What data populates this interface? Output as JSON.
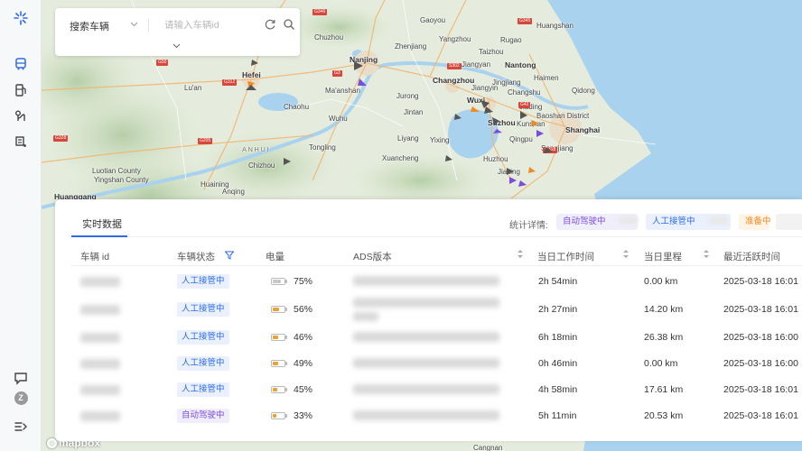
{
  "search": {
    "select_label": "搜索车辆",
    "input_placeholder": "请输入车辆id"
  },
  "map": {
    "attribution": "mapbox",
    "cities": [
      {
        "name": "Chuzhou"
      },
      {
        "name": "Hefei",
        "big": true
      },
      {
        "name": "Lu'an"
      },
      {
        "name": "Chaohu"
      },
      {
        "name": "Ma'anshan"
      },
      {
        "name": "Nanjing",
        "big": true
      },
      {
        "name": "Zhenjiang"
      },
      {
        "name": "Yangzhou"
      },
      {
        "name": "Taizhou"
      },
      {
        "name": "Nantong",
        "big": true
      },
      {
        "name": "Changzhou",
        "big": true
      },
      {
        "name": "Wuxi",
        "big": true
      },
      {
        "name": "Suzhou",
        "big": true
      },
      {
        "name": "Shanghai",
        "big": true
      },
      {
        "name": "Wuhu"
      },
      {
        "name": "Tongling"
      },
      {
        "name": "Chizhou"
      },
      {
        "name": "Xuancheng"
      },
      {
        "name": "Huzhou"
      },
      {
        "name": "Jiaxing"
      },
      {
        "name": "Anqing"
      },
      {
        "name": "Huangshan"
      },
      {
        "name": "Qidong"
      },
      {
        "name": "Luotian County"
      },
      {
        "name": "Yingshan County"
      },
      {
        "name": "Huanggang",
        "big": true
      },
      {
        "name": "Cangnan"
      },
      {
        "name": "Gaoyou"
      },
      {
        "name": "Jiangyin"
      },
      {
        "name": "Changshu"
      },
      {
        "name": "Baoshan District"
      },
      {
        "name": "Jiading"
      },
      {
        "name": "Qingpu"
      },
      {
        "name": "Songjiang"
      },
      {
        "name": "Kunshan"
      },
      {
        "name": "Haimen"
      },
      {
        "name": "Rugao"
      },
      {
        "name": "Jingjiang"
      },
      {
        "name": "Jurong"
      },
      {
        "name": "Liyang"
      },
      {
        "name": "Yixing"
      },
      {
        "name": "Jintan"
      },
      {
        "name": "Huaining"
      },
      {
        "name": "Jiangyan"
      }
    ],
    "region_label": "ANHUI",
    "road_shields": [
      "G50",
      "G3",
      "G312",
      "G42",
      "G205",
      "G328",
      "G318",
      "G346",
      "G345",
      "S302"
    ]
  },
  "panel": {
    "tab_label": "实时数据",
    "stats_label": "统计详情:",
    "stats": {
      "auto": "自动驾驶中",
      "manual": "人工接管中",
      "ready": "准备中"
    },
    "columns": {
      "vehicle_id": "车辆 id",
      "status": "车辆状态",
      "battery": "电量",
      "ads": "ADS版本",
      "work_time": "当日工作时间",
      "mileage": "当日里程",
      "last_active": "最近活跃时间"
    },
    "rows": [
      {
        "status": "人工接管中",
        "status_type": "manual",
        "battery": "75%",
        "battery_level": 0.75,
        "battery_color": "#c8c8c8",
        "work_time": "2h 54min",
        "mileage": "0.00 km",
        "last_active": "2025-03-18 16:01"
      },
      {
        "status": "人工接管中",
        "status_type": "manual",
        "battery": "56%",
        "battery_level": 0.56,
        "battery_color": "#f0a030",
        "work_time": "2h 27min",
        "mileage": "14.20 km",
        "last_active": "2025-03-18 16:01"
      },
      {
        "status": "人工接管中",
        "status_type": "manual",
        "battery": "46%",
        "battery_level": 0.46,
        "battery_color": "#f0a030",
        "work_time": "6h 18min",
        "mileage": "26.38 km",
        "last_active": "2025-03-18 16:00"
      },
      {
        "status": "人工接管中",
        "status_type": "manual",
        "battery": "49%",
        "battery_level": 0.49,
        "battery_color": "#f0a030",
        "work_time": "0h 46min",
        "mileage": "0.00 km",
        "last_active": "2025-03-18 16:00"
      },
      {
        "status": "人工接管中",
        "status_type": "manual",
        "battery": "45%",
        "battery_level": 0.45,
        "battery_color": "#f0a030",
        "work_time": "4h 58min",
        "mileage": "17.61 km",
        "last_active": "2025-03-18 16:01"
      },
      {
        "status": "自动驾驶中",
        "status_type": "auto",
        "battery": "33%",
        "battery_level": 0.33,
        "battery_color": "#f0a030",
        "work_time": "5h 11min",
        "mileage": "20.53 km",
        "last_active": "2025-03-18 16:01"
      }
    ]
  },
  "rail": {
    "icons": [
      "logo-icon",
      "bus-icon",
      "fuel-station-icon",
      "route-icon",
      "vehicle-list-icon",
      "message-icon",
      "user-avatar-icon",
      "collapse-icon"
    ],
    "avatar_letter": "Z"
  },
  "colors": {
    "accent": "#2e6be6",
    "auto": "#7a4cd9",
    "ready": "#f08a24",
    "sea": "#a9d2ee"
  }
}
